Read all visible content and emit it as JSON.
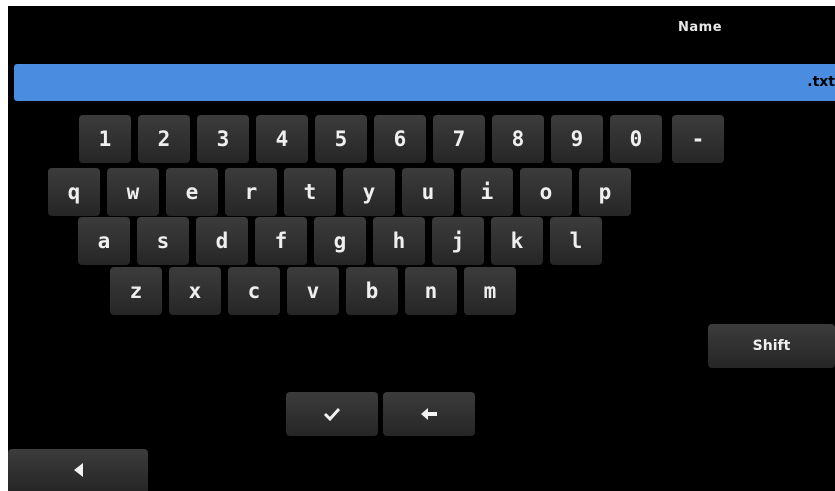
{
  "header": {
    "title": "Name"
  },
  "filename": {
    "value": "",
    "extension": ".txt"
  },
  "keyboard": {
    "rows": [
      [
        "1",
        "2",
        "3",
        "4",
        "5",
        "6",
        "7",
        "8",
        "9",
        "0",
        "-"
      ],
      [
        "q",
        "w",
        "e",
        "r",
        "t",
        "y",
        "u",
        "i",
        "o",
        "p"
      ],
      [
        "a",
        "s",
        "d",
        "f",
        "g",
        "h",
        "j",
        "k",
        "l"
      ],
      [
        "z",
        "x",
        "c",
        "v",
        "b",
        "n",
        "m"
      ]
    ],
    "shift_label": "Shift",
    "enter_icon": "checkmark-icon",
    "backspace_icon": "arrow-left-icon"
  },
  "nav": {
    "back_icon": "triangle-left-icon"
  },
  "colors": {
    "background": "#000000",
    "input_bar": "#4a8de0",
    "key_top": "#3c3c3c",
    "key_bottom": "#262626",
    "key_text": "#efefef"
  }
}
